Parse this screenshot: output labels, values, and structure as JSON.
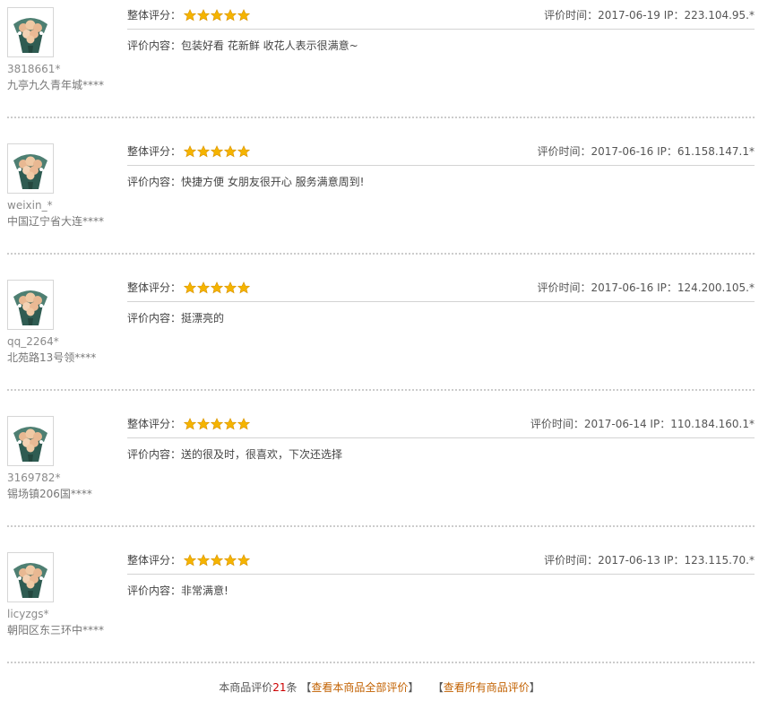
{
  "labels": {
    "rating": "整体评分：",
    "time": "评价时间：",
    "ip": "IP：",
    "content": "评价内容："
  },
  "reviews": [
    {
      "user": "3818661*",
      "location": "九亭九久青年城****",
      "date": "2017-06-19",
      "ip": "223.104.95.*",
      "content": "包装好看 花新鲜 收花人表示很满意~",
      "stars": 5
    },
    {
      "user": "weixin_*",
      "location": "中国辽宁省大连****",
      "date": "2017-06-16",
      "ip": "61.158.147.1*",
      "content": "快捷方便 女朋友很开心 服务满意周到!",
      "stars": 5
    },
    {
      "user": "qq_2264*",
      "location": "北苑路13号领****",
      "date": "2017-06-16",
      "ip": "124.200.105.*",
      "content": "挺漂亮的",
      "stars": 5
    },
    {
      "user": "3169782*",
      "location": "锡场镇206国****",
      "date": "2017-06-14",
      "ip": "110.184.160.1*",
      "content": "送的很及时，很喜欢，下次还选择",
      "stars": 5
    },
    {
      "user": "licyzgs*",
      "location": "朝阳区东三环中****",
      "date": "2017-06-13",
      "ip": "123.115.70.*",
      "content": "非常满意!",
      "stars": 5
    }
  ],
  "footer": {
    "prefix": "本商品评价",
    "count": "21",
    "suffix": "条",
    "link_all": "查看本商品全部评价",
    "link_every": "查看所有商品评价",
    "bracket_open": "【",
    "bracket_close": "】"
  },
  "colors": {
    "star": "#f5b400",
    "link": "#c26100",
    "count": "#cc0000",
    "bouquet_wrap": "#2f5c52",
    "bouquet_flower": "#e8b892"
  },
  "icons": {
    "avatar": "flower-bouquet-icon",
    "star": "star-icon"
  }
}
